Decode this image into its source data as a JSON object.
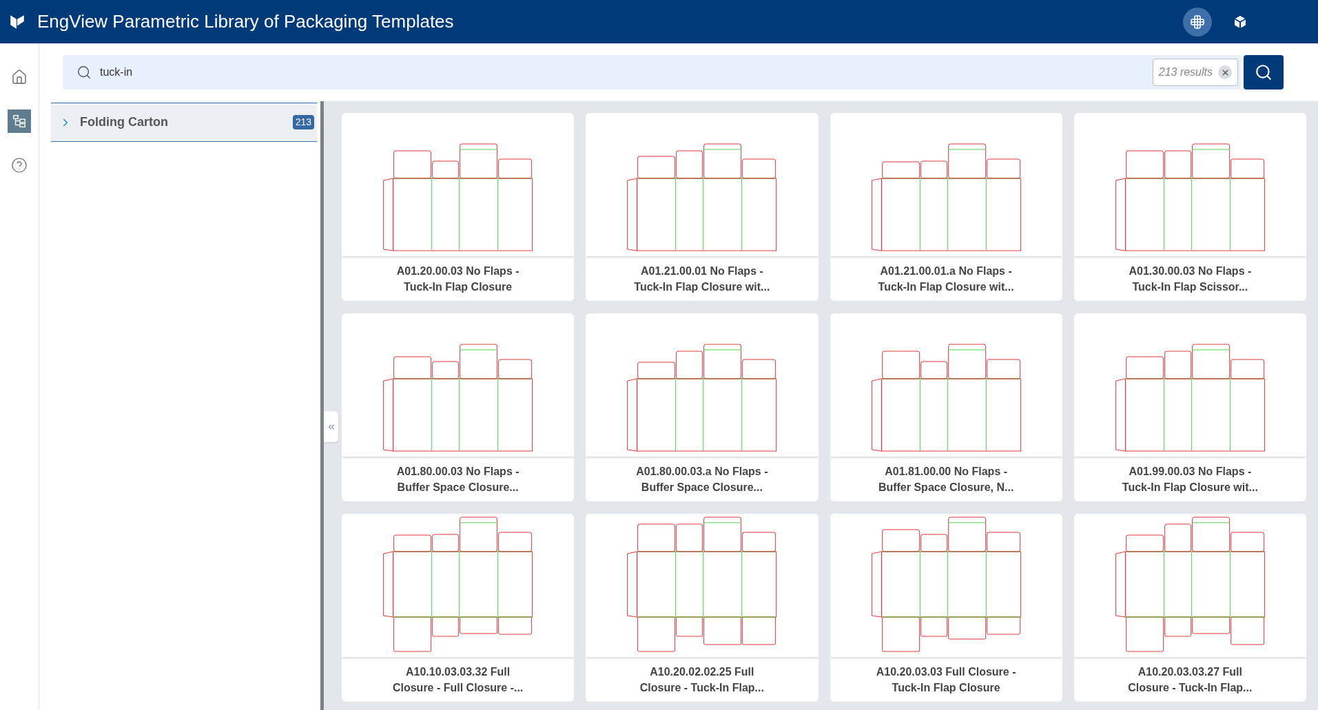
{
  "header": {
    "title": "EngView Parametric Library of Packaging Templates"
  },
  "view_toggles": [
    {
      "kind": "library",
      "selected": true
    },
    {
      "kind": "cube",
      "selected": false
    }
  ],
  "nav": [
    {
      "kind": "home",
      "selected": false
    },
    {
      "kind": "tree",
      "selected": true
    },
    {
      "kind": "help",
      "selected": false
    }
  ],
  "search": {
    "value": "tuck-in",
    "result_count": "213 results"
  },
  "tree": [
    {
      "label": "Folding Carton",
      "count": "213",
      "expanded": false
    }
  ],
  "cards": [
    {
      "title_lines": [
        "A01.20.00.03 No Flaps -",
        "Tuck-In Flap Closure"
      ]
    },
    {
      "title_lines": [
        "A01.21.00.01 No Flaps -",
        "Tuck-In Flap Closure wit..."
      ]
    },
    {
      "title_lines": [
        "A01.21.00.01.a No Flaps -",
        "Tuck-In Flap Closure wit..."
      ]
    },
    {
      "title_lines": [
        "A01.30.00.03 No Flaps -",
        "Tuck-In Flap Scissor..."
      ]
    },
    {
      "title_lines": [
        "A01.80.00.03 No Flaps -",
        "Buffer Space Closure..."
      ]
    },
    {
      "title_lines": [
        "A01.80.00.03.a No Flaps -",
        "Buffer Space Closure..."
      ]
    },
    {
      "title_lines": [
        "A01.81.00.00 No Flaps -",
        "Buffer Space Closure, N..."
      ]
    },
    {
      "title_lines": [
        "A01.99.00.03 No Flaps -",
        "Tuck-In Flap Closure wit..."
      ]
    },
    {
      "title_lines": [
        "A10.10.03.03.32 Full",
        "Closure - Full Closure -..."
      ]
    },
    {
      "title_lines": [
        "A10.20.02.02.25 Full",
        "Closure - Tuck-In Flap..."
      ]
    },
    {
      "title_lines": [
        "A10.20.03.03 Full Closure -",
        "Tuck-In Flap Closure"
      ]
    },
    {
      "title_lines": [
        "A10.20.03.03.27 Full",
        "Closure - Tuck-In Flap..."
      ]
    }
  ]
}
